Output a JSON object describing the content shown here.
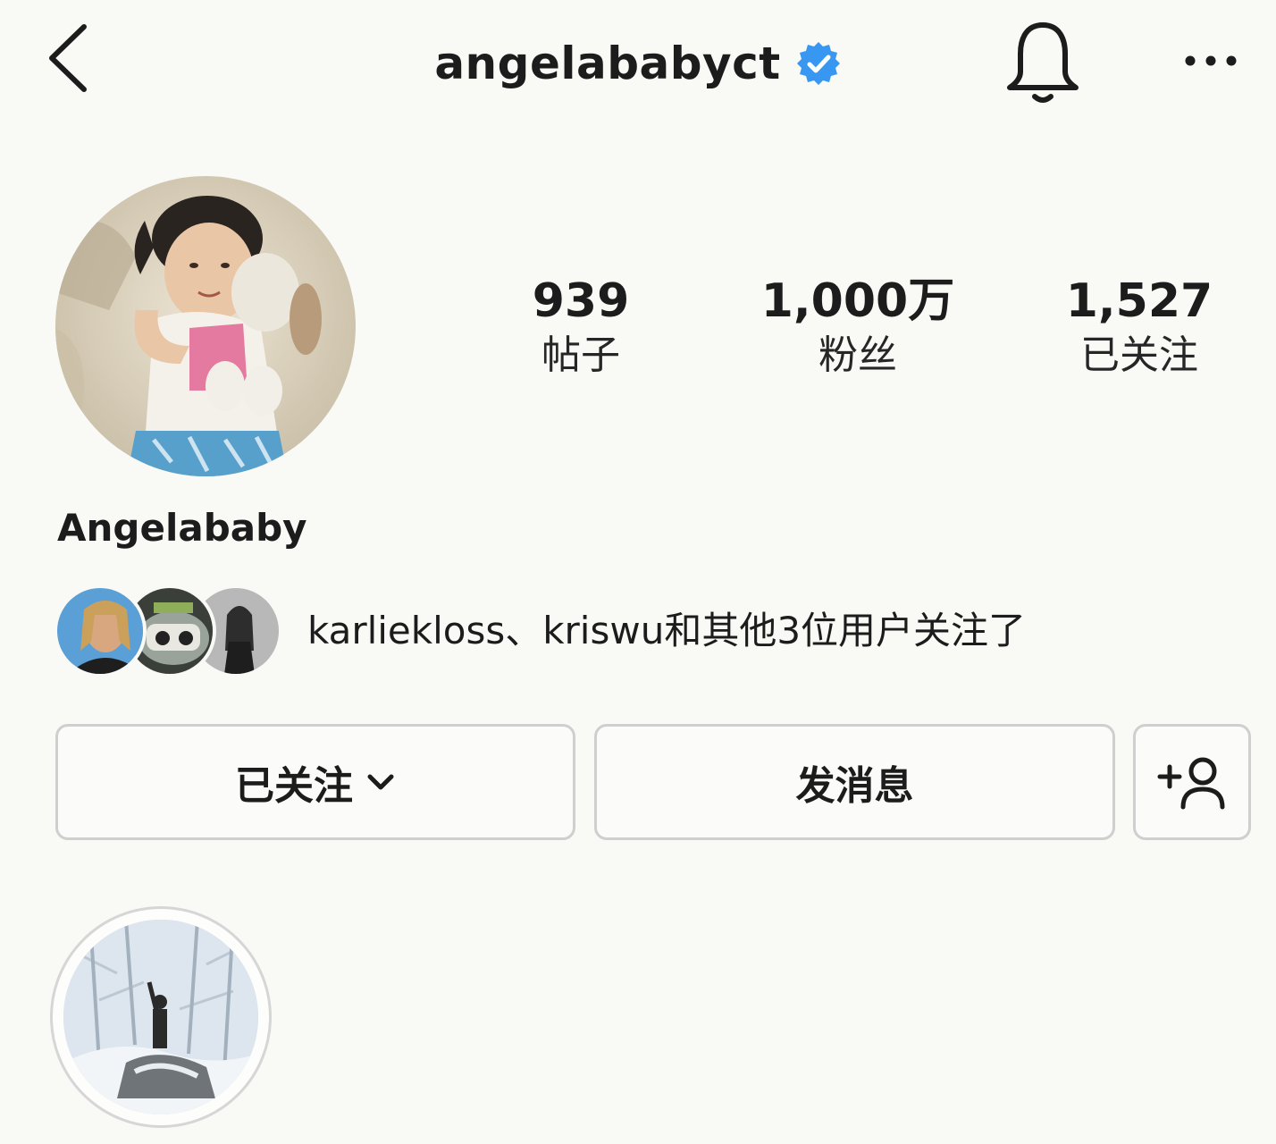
{
  "header": {
    "username": "angelababyct",
    "verified_icon": "verified-badge-icon",
    "back_icon": "chevron-left-icon",
    "bell_icon": "bell-icon",
    "more_icon": "more-dots-icon",
    "accent_color": "#3897f0"
  },
  "profile": {
    "display_name": "Angelababy",
    "stats": {
      "posts": {
        "value": "939",
        "label": "帖子"
      },
      "followers": {
        "value": "1,000万",
        "label": "粉丝"
      },
      "following": {
        "value": "1,527",
        "label": "已关注"
      }
    },
    "followed_by_text": "karliekloss、kriswu和其他3位用户关注了"
  },
  "actions": {
    "following_label": "已关注",
    "message_label": "发消息",
    "suggest_icon": "add-person-icon"
  }
}
